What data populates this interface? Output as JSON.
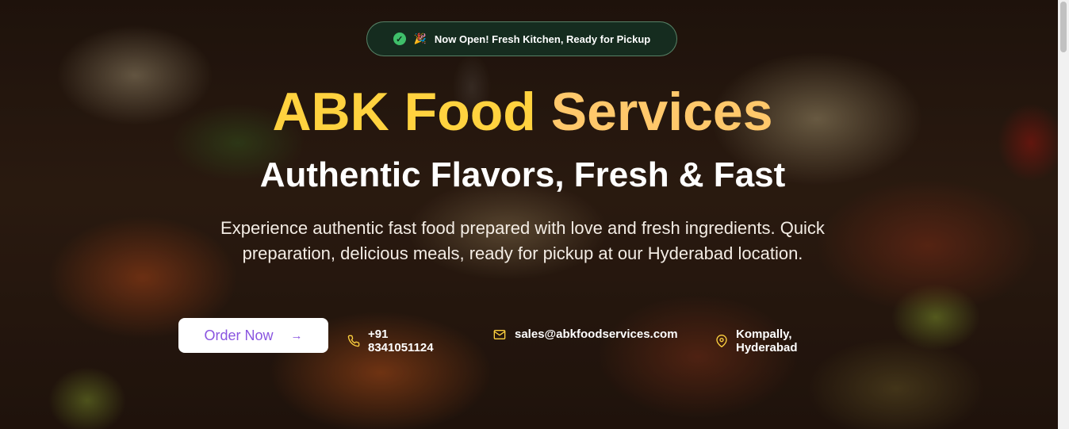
{
  "badge": {
    "icon": "check-circle-icon",
    "emoji": "🎉",
    "text": "Now Open! Fresh Kitchen, Ready for Pickup"
  },
  "hero": {
    "title_part1": "ABK Food",
    "title_part2": "Services",
    "subtitle": "Authentic Flavors, Fresh & Fast",
    "description": "Experience authentic fast food prepared with love and fresh ingredients. Quick preparation, delicious meals, ready for pickup at our Hyderabad location."
  },
  "cta": {
    "order_label": "Order Now",
    "arrow": "→"
  },
  "contacts": {
    "phone": "+91 8341051124",
    "email": "sales@abkfoodservices.com",
    "location": "Kompally, Hyderabad"
  },
  "colors": {
    "title_yellow": "#ffd23f",
    "title_orange": "#ffc86b",
    "button_text": "#8a55e0",
    "badge_check": "#3fbf6a"
  }
}
